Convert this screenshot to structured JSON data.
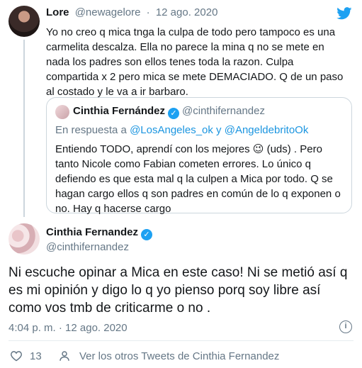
{
  "reply": {
    "name": "Lore",
    "handle": "@newagelore",
    "separator": "·",
    "date": "12 ago. 2020",
    "text": "Yo no creo q mica tnga la culpa de todo pero tampoco es una carmelita descalza. Ella no parece la mina q no se mete en nada los padres son ellos tenes toda la razon. Culpa compartida x 2 pero mica se mete DEMACIADO. Q de un paso al costado y le va a ir barbaro."
  },
  "quote": {
    "name": "Cinthia Fernández",
    "handle": "@cinthifernandez",
    "reply_prefix": "En respuesta a",
    "reply_mentions": "@LosAngeles_ok y @AngeldebritoOk",
    "text_before_emoji": "Entiendo TODO, aprendí con los mejores",
    "emoji": "😉",
    "text_after_emoji": "(uds) . Pero tanto Nicole como Fabian cometen errores. Lo único q defiendo es que esta mal q la culpen a Mica por todo. Q se hagan cargo ellos q son padres en común de lo q exponen o no. Hay q hacerse cargo"
  },
  "main": {
    "name": "Cinthia Fernandez",
    "handle": "@cinthifernandez",
    "text": "Ni escuche opinar a Mica en este caso! Ni se metió así q es mi opinión y digo lo q yo pienso porq soy libre así como vos tmb de criticarme o no .",
    "timestamp": "4:04 p. m. · 12 ago. 2020",
    "likes": "13",
    "see_more": "Ver los otros Tweets de Cinthia Fernandez"
  },
  "colors": {
    "accent": "#1da1f2",
    "link": "#1b95e0",
    "muted": "#657786",
    "border": "#ccd6dd"
  },
  "icons": {
    "brand": "twitter-bird-icon",
    "verified": "verified-badge-icon",
    "info": "info-icon",
    "like": "heart-icon",
    "profile": "person-icon"
  }
}
